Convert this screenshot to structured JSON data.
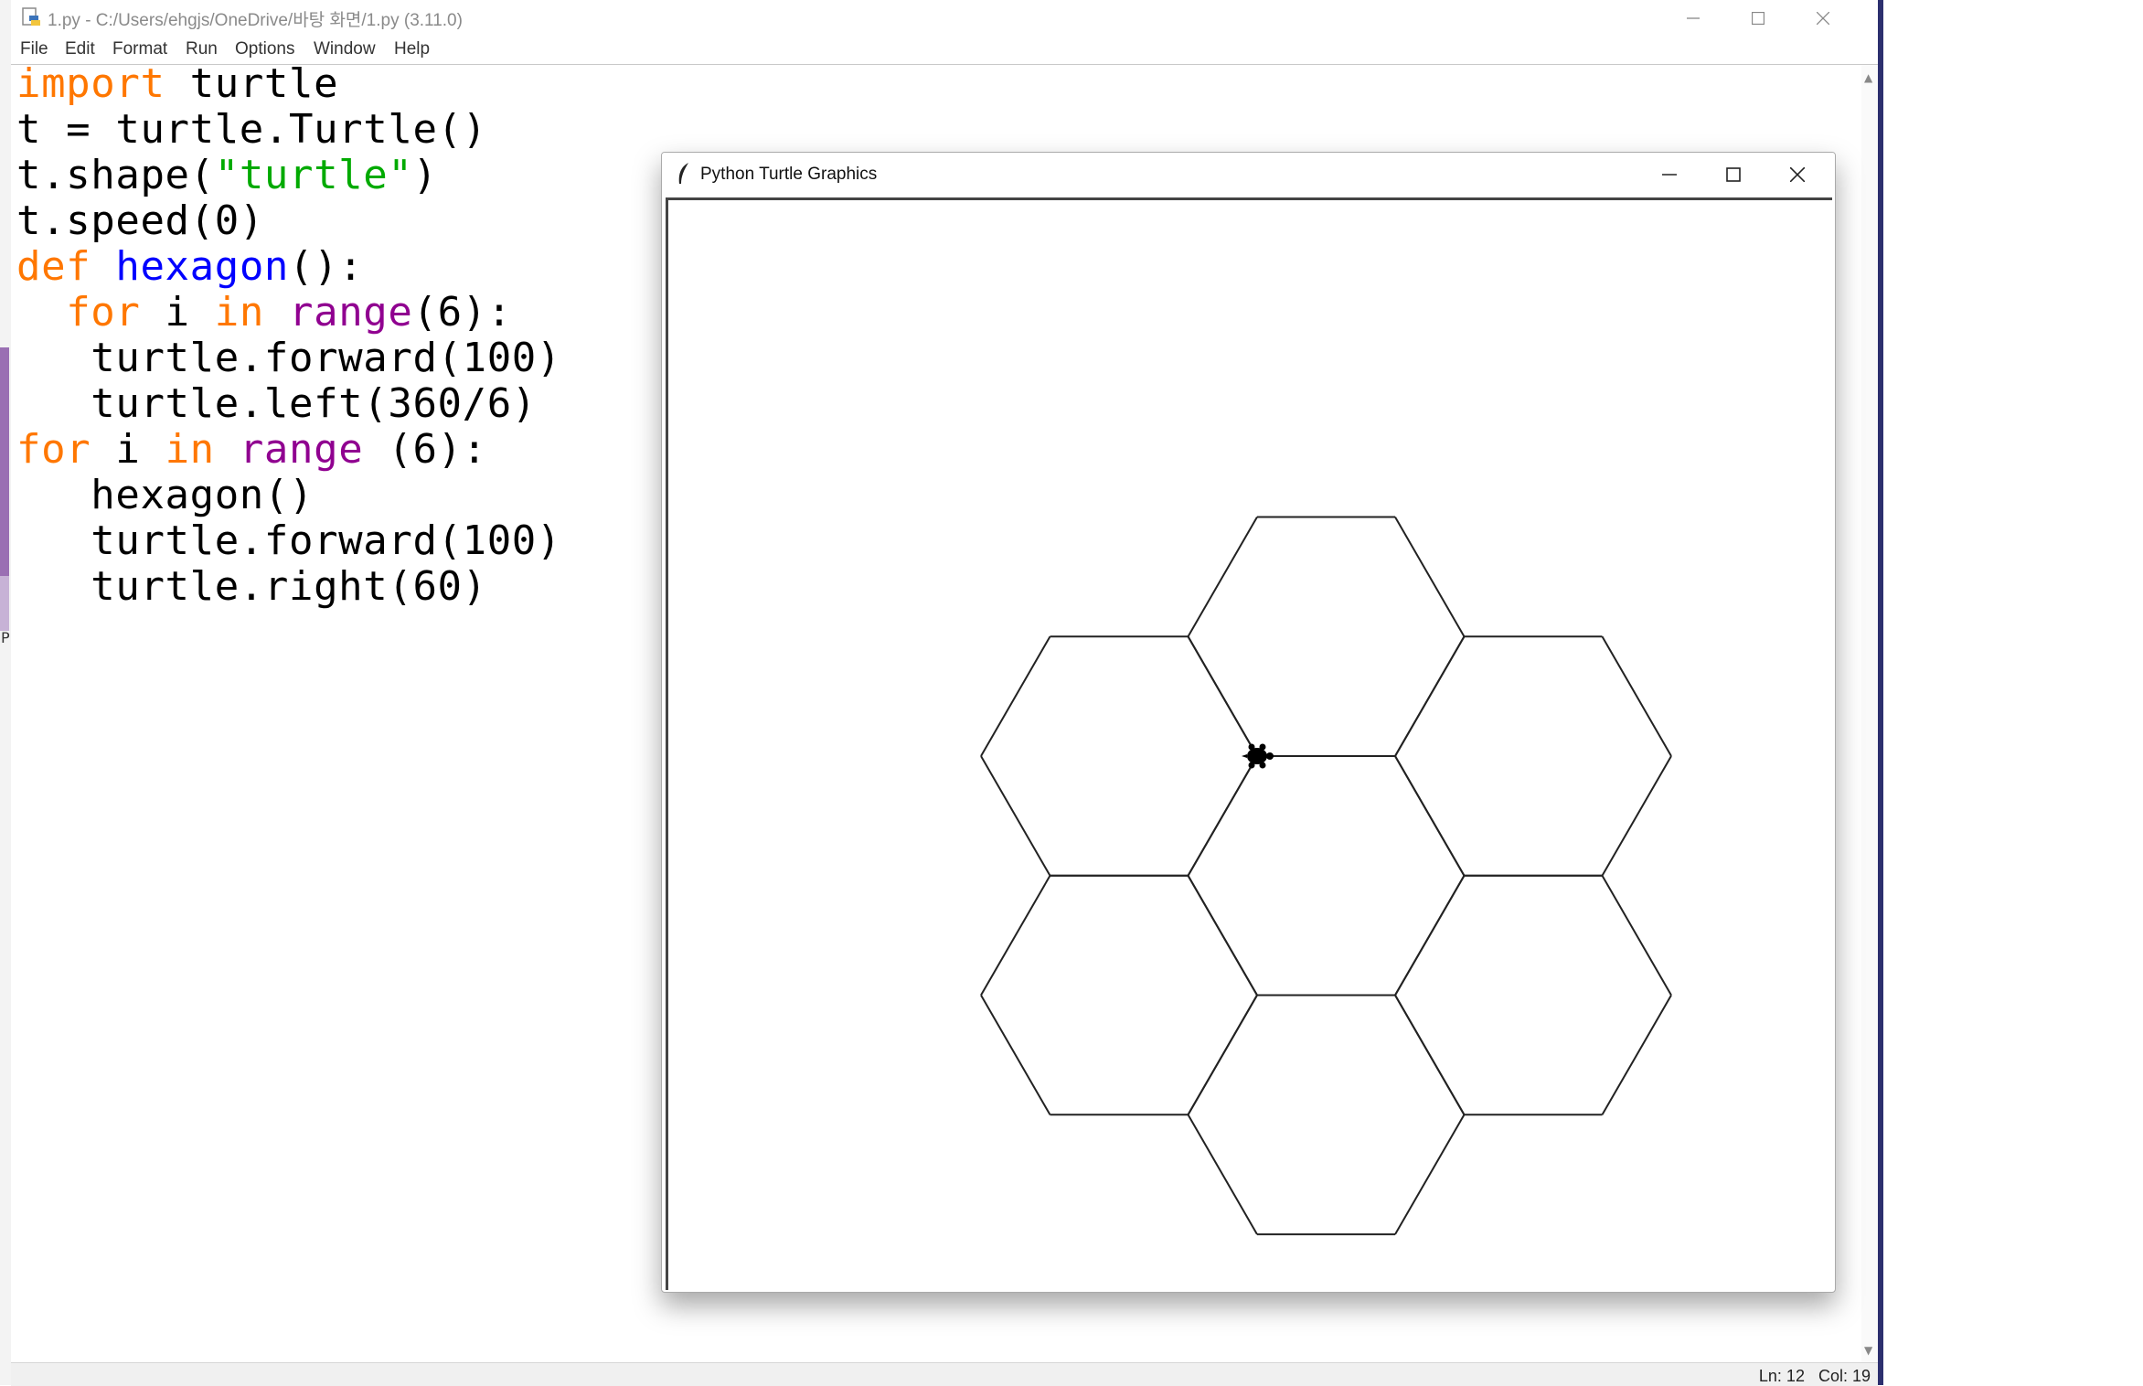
{
  "idle": {
    "title": "1.py - C:/Users/ehgjs/OneDrive/바탕 화면/1.py (3.11.0)",
    "menu": [
      "File",
      "Edit",
      "Format",
      "Run",
      "Options",
      "Window",
      "Help"
    ],
    "code": [
      [
        {
          "t": "import",
          "c": "kw"
        },
        {
          "t": " turtle",
          "c": ""
        }
      ],
      [
        {
          "t": "t = turtle.Turtle()",
          "c": ""
        }
      ],
      [
        {
          "t": "t.shape(",
          "c": ""
        },
        {
          "t": "\"turtle\"",
          "c": "str"
        },
        {
          "t": ")",
          "c": ""
        }
      ],
      [
        {
          "t": "t.speed(0)",
          "c": ""
        }
      ],
      [
        {
          "t": "def",
          "c": "kw"
        },
        {
          "t": " ",
          "c": ""
        },
        {
          "t": "hexagon",
          "c": "fn"
        },
        {
          "t": "():",
          "c": ""
        }
      ],
      [
        {
          "t": "  ",
          "c": ""
        },
        {
          "t": "for",
          "c": "kw"
        },
        {
          "t": " i ",
          "c": ""
        },
        {
          "t": "in",
          "c": "kw"
        },
        {
          "t": " ",
          "c": ""
        },
        {
          "t": "range",
          "c": "bi"
        },
        {
          "t": "(6):",
          "c": ""
        }
      ],
      [
        {
          "t": "   turtle.forward(100)",
          "c": ""
        }
      ],
      [
        {
          "t": "   turtle.left(360/6)",
          "c": ""
        }
      ],
      [
        {
          "t": "for",
          "c": "kw"
        },
        {
          "t": " i ",
          "c": ""
        },
        {
          "t": "in",
          "c": "kw"
        },
        {
          "t": " ",
          "c": ""
        },
        {
          "t": "range",
          "c": "bi"
        },
        {
          "t": " (6):",
          "c": ""
        }
      ],
      [
        {
          "t": "   hexagon()",
          "c": ""
        }
      ],
      [
        {
          "t": "   turtle.forward(100)",
          "c": ""
        }
      ],
      [
        {
          "t": "   turtle.right(60)",
          "c": ""
        }
      ]
    ],
    "status": "Ln: 12   Col: 19"
  },
  "turtle_window": {
    "title": "Python Turtle Graphics"
  },
  "desktop": {
    "edge_letter": "P"
  },
  "colors": {
    "keyword": "#ff7700",
    "function_name": "#0000ff",
    "builtin": "#900090",
    "string": "#00aa00",
    "hex_stroke": "#222222"
  }
}
